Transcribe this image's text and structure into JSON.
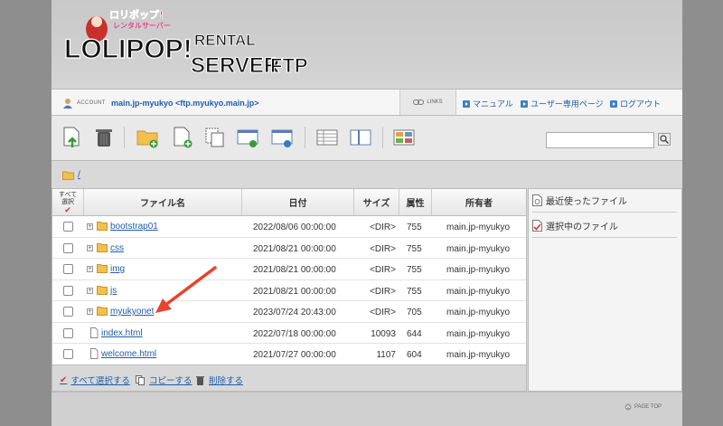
{
  "header": {
    "logo_tag": "ロリポップ!",
    "logo_sub": "レンタルサーバー",
    "logo_main": "LOLIPOP!",
    "logo_rental": "RENTAL",
    "logo_server": "SERVER",
    "logo_ftp": "FTP"
  },
  "account": {
    "label": "ACCOUNT",
    "name": "main.jp-myukyo <ftp.myukyo.main.jp>",
    "links_label": "LINKS",
    "links": [
      {
        "label": "マニュアル",
        "icon": "arrow-bullet-icon"
      },
      {
        "label": "ユーザー専用ページ",
        "icon": "arrow-bullet-icon"
      },
      {
        "label": "ログアウト",
        "icon": "arrow-bullet-icon"
      }
    ]
  },
  "toolbar": {
    "search_placeholder": ""
  },
  "path": {
    "current": "/"
  },
  "table": {
    "columns": {
      "select_all": "すべて\n選択",
      "name": "ファイル名",
      "date": "日付",
      "size": "サイズ",
      "perm": "属性",
      "owner": "所有者"
    },
    "rows": [
      {
        "type": "folder",
        "name": "bootstrap01",
        "date": "2022/08/06 00:00:00",
        "size": "<DIR>",
        "perm": "755",
        "owner": "main.jp-myukyo"
      },
      {
        "type": "folder",
        "name": "css",
        "date": "2021/08/21 00:00:00",
        "size": "<DIR>",
        "perm": "755",
        "owner": "main.jp-myukyo"
      },
      {
        "type": "folder",
        "name": "img",
        "date": "2021/08/21 00:00:00",
        "size": "<DIR>",
        "perm": "755",
        "owner": "main.jp-myukyo"
      },
      {
        "type": "folder",
        "name": "js",
        "date": "2021/08/21 00:00:00",
        "size": "<DIR>",
        "perm": "755",
        "owner": "main.jp-myukyo"
      },
      {
        "type": "folder",
        "name": "myukyonet",
        "date": "2023/07/24 20:43:00",
        "size": "<DIR>",
        "perm": "705",
        "owner": "main.jp-myukyo"
      },
      {
        "type": "file",
        "name": "index.html",
        "date": "2022/07/18 00:00:00",
        "size": "10093",
        "perm": "644",
        "owner": "main.jp-myukyo"
      },
      {
        "type": "file",
        "name": "welcome.html",
        "date": "2021/07/27 00:00:00",
        "size": "1107",
        "perm": "604",
        "owner": "main.jp-myukyo"
      }
    ]
  },
  "actions": {
    "select_all": "すべて選択する",
    "copy": "コピーする",
    "delete": "削除する"
  },
  "sidepanel": {
    "recent": "最近使ったファイル",
    "selected": "選択中のファイル"
  },
  "footer": {
    "pagetop": "PAGE TOP"
  },
  "colors": {
    "link": "#1f5ea8",
    "annotation_arrow": "#e8432b",
    "folder": "#f2c04e"
  }
}
